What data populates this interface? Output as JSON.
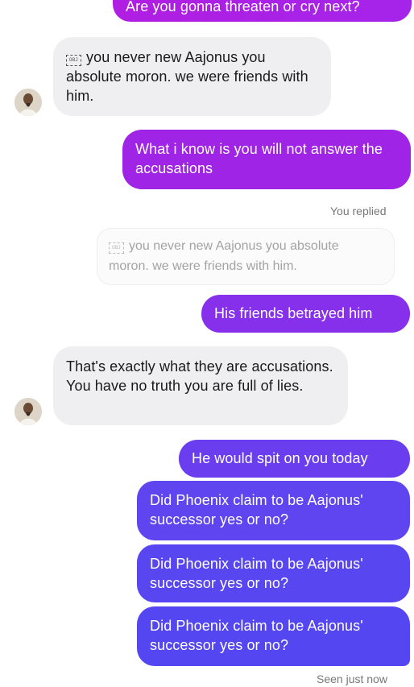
{
  "messages": {
    "top_cut": "Are you gonna threaten or cry next?",
    "m1": {
      "icon": "OBJ",
      "text": "you never new Aajonus you absolute moron. we were friends with him."
    },
    "m2": "What i know is you will not answer the accusations",
    "replied_label": "You replied",
    "quoted": {
      "icon": "OBJ",
      "text": "you never new Aajonus you absolute moron. we were friends with him."
    },
    "m3": "His friends betrayed him",
    "m4": "That's exactly what they are accusations. You have no truth you are full of lies.",
    "m5": "He would spit on you today",
    "m6": "Did Phoenix claim to be Aajonus' successor yes or no?",
    "m7": "Did Phoenix claim to be Aajonus' successor yes or no?",
    "m8": "Did Phoenix claim to be Aajonus' successor yes or no?",
    "seen_label": "Seen just now"
  },
  "colors": {
    "incoming_bg": "#efeff1",
    "outgoing_magenta": "#a520e6",
    "outgoing_violet": "#8a2fee",
    "outgoing_blue": "#5b46f0"
  },
  "avatar": {
    "icon": "person-avatar"
  }
}
